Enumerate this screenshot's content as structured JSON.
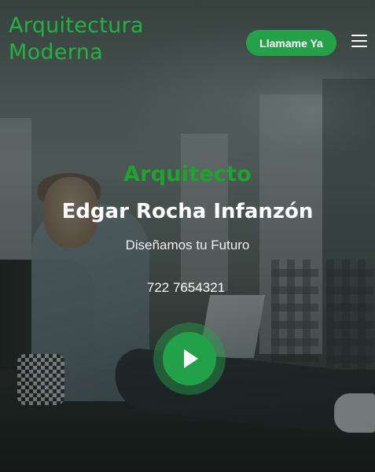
{
  "header": {
    "logo_line1": "Arquitectura",
    "logo_line2": "Moderna",
    "call_button_label": "Llamame Ya",
    "menu_icon": "hamburger-menu-icon"
  },
  "hero": {
    "role": "Arquitecto",
    "name": "Edgar Rocha Infanzón",
    "tagline": "Diseñamos tu Futuro",
    "phone": "722 7654321",
    "play_icon": "play-icon"
  },
  "colors": {
    "brand_green": "#22b33f",
    "button_green": "#25a249",
    "text_white": "#ffffff"
  }
}
